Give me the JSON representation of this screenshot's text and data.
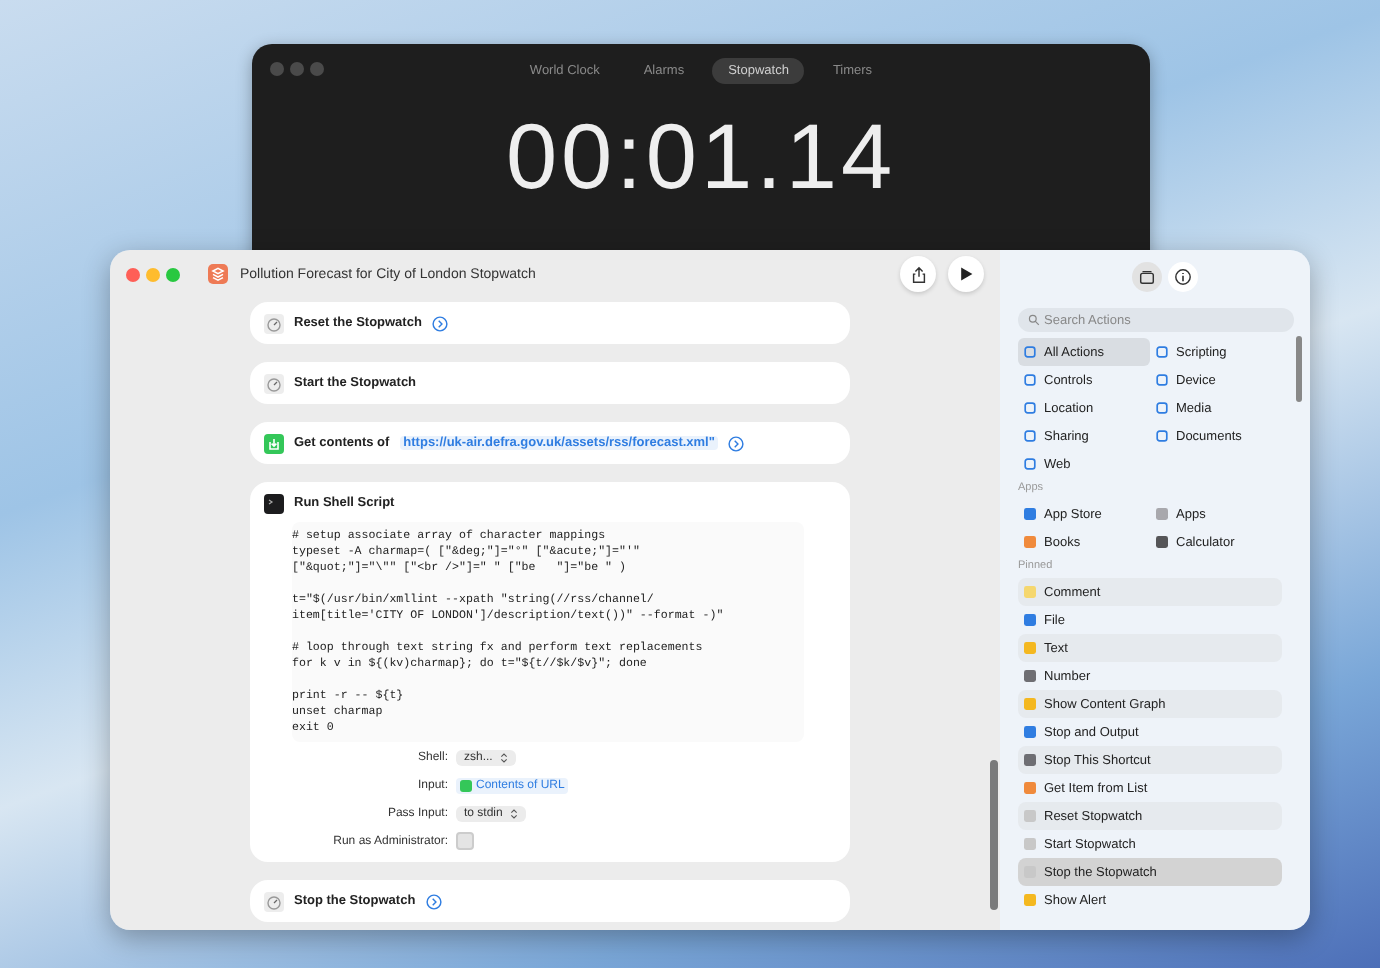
{
  "clock_window": {
    "tabs": [
      {
        "label": "World Clock",
        "selected": false
      },
      {
        "label": "Alarms",
        "selected": false
      },
      {
        "label": "Stopwatch",
        "selected": true
      },
      {
        "label": "Timers",
        "selected": false
      }
    ],
    "time": "00:01.14"
  },
  "shortcut_window": {
    "title": "Pollution Forecast for City of London Stopwatch",
    "actions": [
      {
        "kind": "stopwatch",
        "label": "Reset the Stopwatch",
        "info_button": true
      },
      {
        "kind": "stopwatch",
        "label": "Start the Stopwatch",
        "info_button": false
      },
      {
        "kind": "url",
        "label": "Get contents of",
        "url": "https://uk-air.defra.gov.uk/assets/rss/forecast.xml\"",
        "info_button": true
      },
      {
        "kind": "shell",
        "label": "Run Shell Script",
        "info_button": false,
        "script": "# setup associate array of character mappings\ntypeset -A charmap=( [\"&deg;\"]=\"°\" [\"&acute;\"]=\"'\"\n[\"&quot;\"]=\"\\\"\" [\"<br />\"]=\" \" [\"be   \"]=\"be \" )\n\nt=\"$(/usr/bin/xmllint --xpath \"string(//rss/channel/\nitem[title='CITY OF LONDON']/description/text())\" --format -)\"\n\n# loop through text string fx and perform text replacements\nfor k v in ${(kv)charmap}; do t=\"${t//$k/$v}\"; done\n\nprint -r -- ${t}\nunset charmap\nexit 0",
        "params": [
          {
            "kind": "popup",
            "label": "Shell:",
            "value": "zsh..."
          },
          {
            "kind": "variable",
            "label": "Input:",
            "value": "Contents of URL"
          },
          {
            "kind": "popup",
            "label": "Pass Input:",
            "value": "to stdin"
          },
          {
            "kind": "checkbox",
            "label": "Run as Administrator:",
            "checked": false
          }
        ]
      },
      {
        "kind": "stopwatch",
        "label": "Stop the Stopwatch",
        "info_button": true
      }
    ]
  },
  "sidebar": {
    "view_buttons": [
      {
        "kind": "library",
        "selected": true
      },
      {
        "kind": "info",
        "selected": false
      }
    ],
    "search": {
      "placeholder": "Search Actions"
    },
    "categories": [
      {
        "label": "All Actions",
        "selected": true
      },
      {
        "label": "Scripting",
        "selected": false
      },
      {
        "label": "Controls",
        "selected": false
      },
      {
        "label": "Device",
        "selected": false
      },
      {
        "label": "Location",
        "selected": false
      },
      {
        "label": "Media",
        "selected": false
      },
      {
        "label": "Sharing",
        "selected": false
      },
      {
        "label": "Documents",
        "selected": false
      },
      {
        "label": "Web",
        "selected": false
      }
    ],
    "apps_heading": "Apps",
    "apps": [
      {
        "label": "App Store",
        "color": "#2f7de1"
      },
      {
        "label": "Apps",
        "color": "#a8a8ad"
      },
      {
        "label": "Books",
        "color": "#f08a3c"
      },
      {
        "label": "Calculator",
        "color": "#555558"
      }
    ],
    "pinned_heading": "Pinned",
    "pinned": [
      {
        "label": "Comment",
        "color": "#f5d76e",
        "selected": false
      },
      {
        "label": "File",
        "color": "#2f7de1",
        "selected": false
      },
      {
        "label": "Text",
        "color": "#f4b820",
        "selected": false
      },
      {
        "label": "Number",
        "color": "#6e6e73",
        "selected": false
      },
      {
        "label": "Show Content Graph",
        "color": "#f4b820",
        "selected": false
      },
      {
        "label": "Stop and Output",
        "color": "#2f7de1",
        "selected": false
      },
      {
        "label": "Stop This Shortcut",
        "color": "#6e6e73",
        "selected": false
      },
      {
        "label": "Get Item from List",
        "color": "#f08a3c",
        "selected": false
      },
      {
        "label": "Reset Stopwatch",
        "color": "#c8c8c8",
        "selected": false
      },
      {
        "label": "Start Stopwatch",
        "color": "#c8c8c8",
        "selected": false
      },
      {
        "label": "Stop the Stopwatch",
        "color": "#c8c8c8",
        "selected": true
      },
      {
        "label": "Show Alert",
        "color": "#f4b820",
        "selected": false
      }
    ]
  }
}
